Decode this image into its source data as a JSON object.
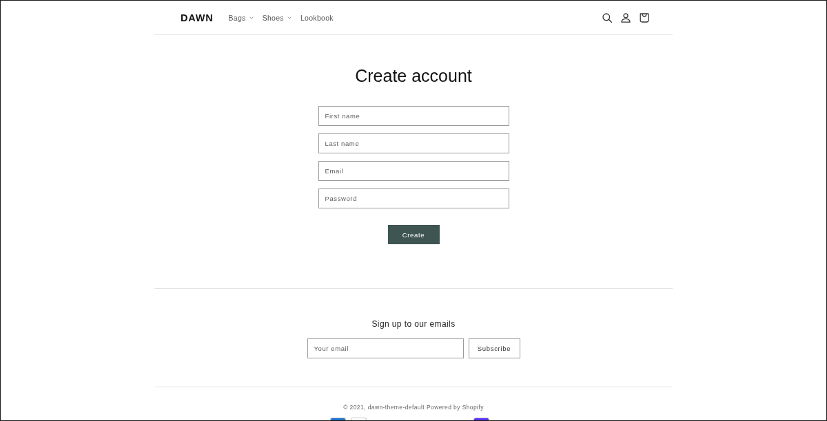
{
  "header": {
    "logo": "DAWN",
    "nav": [
      {
        "label": "Bags",
        "dropdown": true
      },
      {
        "label": "Shoes",
        "dropdown": true
      },
      {
        "label": "Lookbook",
        "dropdown": false
      }
    ]
  },
  "main": {
    "title": "Create account",
    "fields": [
      {
        "placeholder": "First name"
      },
      {
        "placeholder": "Last name"
      },
      {
        "placeholder": "Email"
      },
      {
        "placeholder": "Password"
      }
    ],
    "submit": "Create"
  },
  "newsletter": {
    "heading": "Sign up to our emails",
    "email": {
      "placeholder": "Your email"
    },
    "button": "Subscribe"
  },
  "footer": {
    "copyright": "© 2021, dawn-theme-default",
    "powered_by": "Powered by Shopify",
    "payment_icons": [
      {
        "color": "#1f72cd"
      },
      {
        "color": "#ffffff"
      },
      {
        "color": "#5a31f4"
      }
    ]
  }
}
